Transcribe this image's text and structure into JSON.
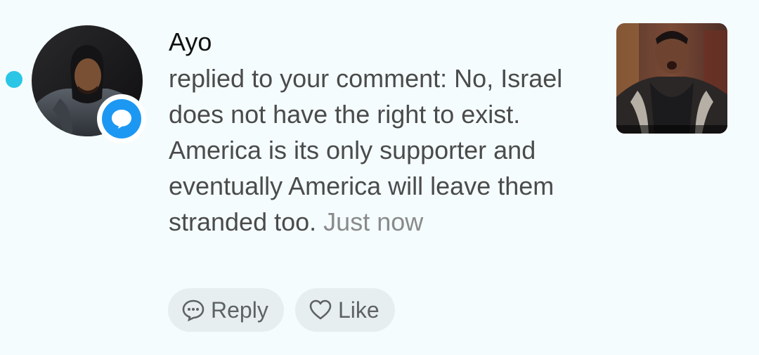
{
  "notification": {
    "username": "Ayo",
    "message": "replied to your comment: No, Israel does not have the right to exist. America is its only supporter and eventually America will leave them stranded too.",
    "timestamp": "Just now",
    "unread": true,
    "badge_icon": "comment-bubble-icon"
  },
  "actions": {
    "reply_label": "Reply",
    "like_label": "Like"
  },
  "colors": {
    "background": "#f4fcfd",
    "unread_dot": "#2bc6e6",
    "badge_blue": "#1d98f2",
    "pill_background": "#e6eeef"
  }
}
